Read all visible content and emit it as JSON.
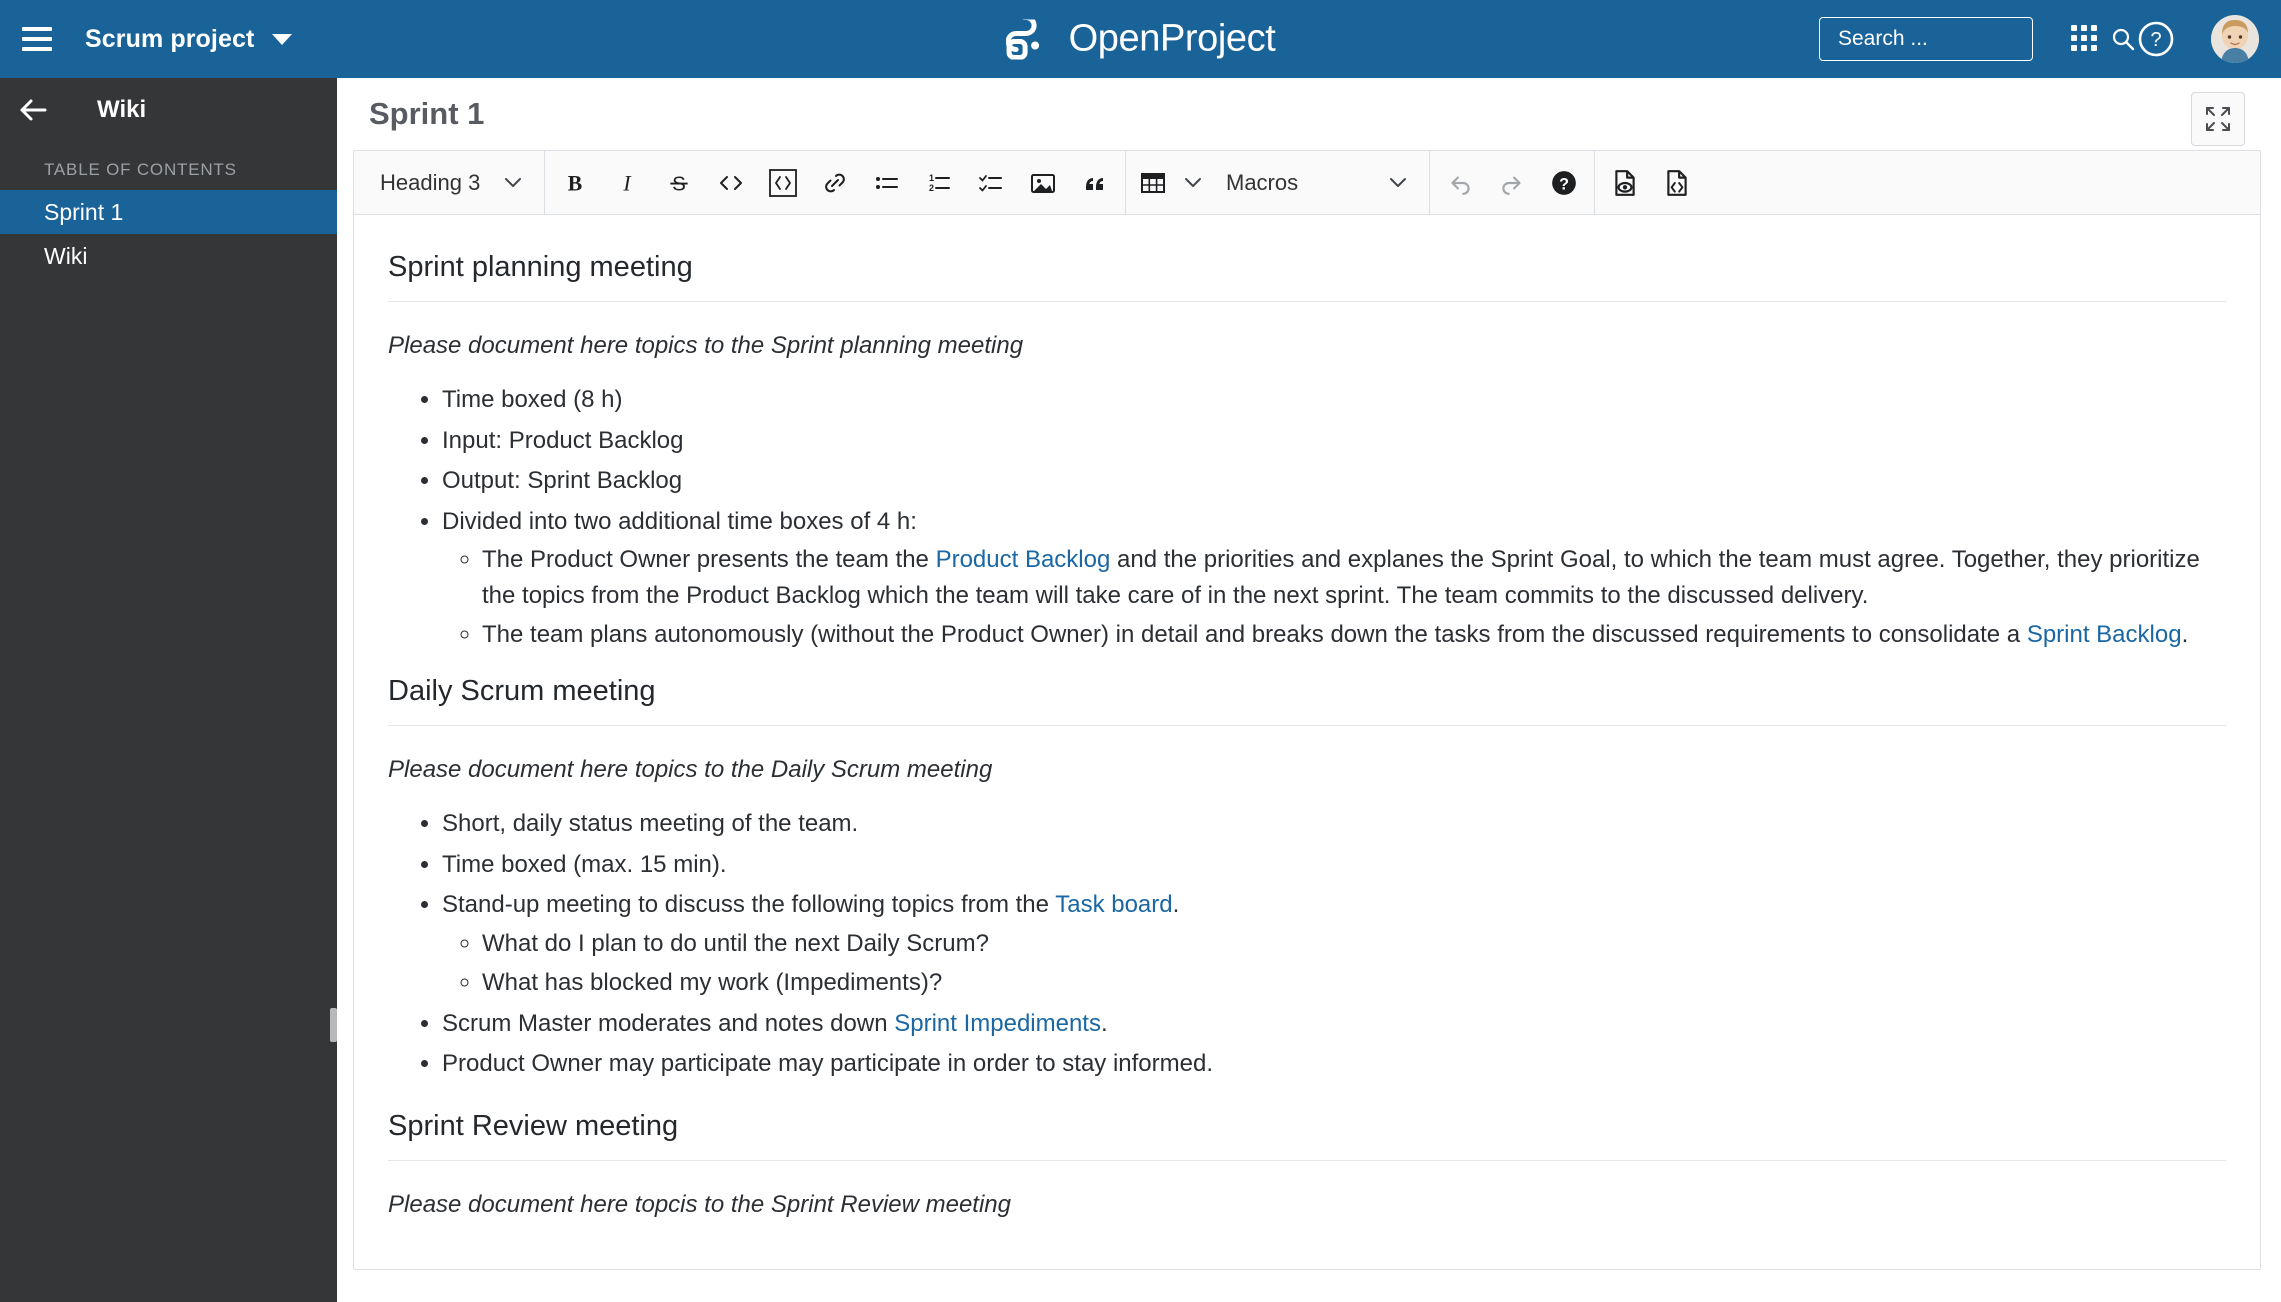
{
  "header": {
    "menu_icon": "hamburger-icon",
    "project_name": "Scrum project",
    "brand_text": "OpenProject",
    "search": {
      "placeholder": "Search ...",
      "value": ""
    },
    "icons": {
      "search": "search-icon",
      "modules": "grid-modules-icon",
      "help": "help-circle-icon",
      "avatar": "user-avatar"
    }
  },
  "sidebar": {
    "back_label": "back-arrow-icon",
    "title": "Wiki",
    "section_label": "TABLE OF CONTENTS",
    "items": [
      {
        "label": "Sprint 1",
        "active": true
      },
      {
        "label": "Wiki",
        "active": false
      }
    ]
  },
  "page": {
    "title": "Sprint 1",
    "expand_label": "fullscreen-icon"
  },
  "toolbar": {
    "paragraph_style": "Heading 3",
    "macros_label": "Macros",
    "buttons": [
      {
        "name": "bold",
        "glyph": "B"
      },
      {
        "name": "italic",
        "glyph": "I"
      },
      {
        "name": "strikethrough",
        "glyph": "S"
      },
      {
        "name": "inline-code",
        "glyph": "<>"
      },
      {
        "name": "code-block",
        "glyph": "<>"
      },
      {
        "name": "link",
        "glyph": "link"
      },
      {
        "name": "bulleted-list",
        "glyph": "ul"
      },
      {
        "name": "numbered-list",
        "glyph": "ol"
      },
      {
        "name": "todo-list",
        "glyph": "checklist"
      },
      {
        "name": "insert-image",
        "glyph": "image"
      },
      {
        "name": "block-quote",
        "glyph": "quote"
      },
      {
        "name": "insert-table",
        "glyph": "table"
      },
      {
        "name": "undo",
        "glyph": "undo"
      },
      {
        "name": "redo",
        "glyph": "redo"
      },
      {
        "name": "help",
        "glyph": "help"
      },
      {
        "name": "preview",
        "glyph": "preview"
      },
      {
        "name": "markdown-source",
        "glyph": "source"
      }
    ]
  },
  "document": {
    "sections": [
      {
        "heading": "Sprint planning meeting",
        "intro": "Please document here topics to the Sprint planning meeting",
        "items": [
          {
            "text": "Time boxed (8 h)"
          },
          {
            "text": "Input: Product Backlog"
          },
          {
            "text": "Output: Sprint Backlog"
          },
          {
            "text": "Divided into two additional time boxes of 4 h:",
            "children": [
              {
                "parts": [
                  {
                    "t": "The Product Owner presents the team the "
                  },
                  {
                    "t": "Product Backlog",
                    "link": true
                  },
                  {
                    "t": " and the priorities and explanes the Sprint Goal, to which the team must agree. Together, they prioritize the topics from the Product Backlog which the team will take care of in the next sprint. The team commits to the discussed delivery."
                  }
                ]
              },
              {
                "parts": [
                  {
                    "t": "The team plans autonomously (without the Product Owner) in detail and breaks down the tasks from the discussed requirements to consolidate a "
                  },
                  {
                    "t": "Sprint Backlog",
                    "link": true
                  },
                  {
                    "t": "."
                  }
                ]
              }
            ]
          }
        ]
      },
      {
        "heading": "Daily Scrum meeting",
        "intro": "Please document here topics to the Daily Scrum meeting",
        "items": [
          {
            "text": "Short, daily status meeting of the team."
          },
          {
            "text": "Time boxed (max. 15 min)."
          },
          {
            "parts": [
              {
                "t": "Stand-up meeting to discuss the following topics from the "
              },
              {
                "t": "Task board",
                "link": true
              },
              {
                "t": "."
              }
            ],
            "children": [
              {
                "parts": [
                  {
                    "t": "What do I plan to do until the next Daily Scrum?"
                  }
                ]
              },
              {
                "parts": [
                  {
                    "t": "What has blocked my work (Impediments)?"
                  }
                ]
              }
            ]
          },
          {
            "parts": [
              {
                "t": "Scrum Master moderates and notes down "
              },
              {
                "t": "Sprint Impediments",
                "link": true
              },
              {
                "t": "."
              }
            ]
          },
          {
            "text": "Product Owner may participate may participate in order to stay informed."
          }
        ]
      },
      {
        "heading": "Sprint Review meeting",
        "intro": "Please document here topcis to the Sprint Review meeting",
        "items": []
      }
    ]
  },
  "colors": {
    "header_blue": "#1a6399",
    "sidebar_dark": "#353638",
    "link_blue": "#1a67a3",
    "toolbar_bg": "#fafafa"
  }
}
